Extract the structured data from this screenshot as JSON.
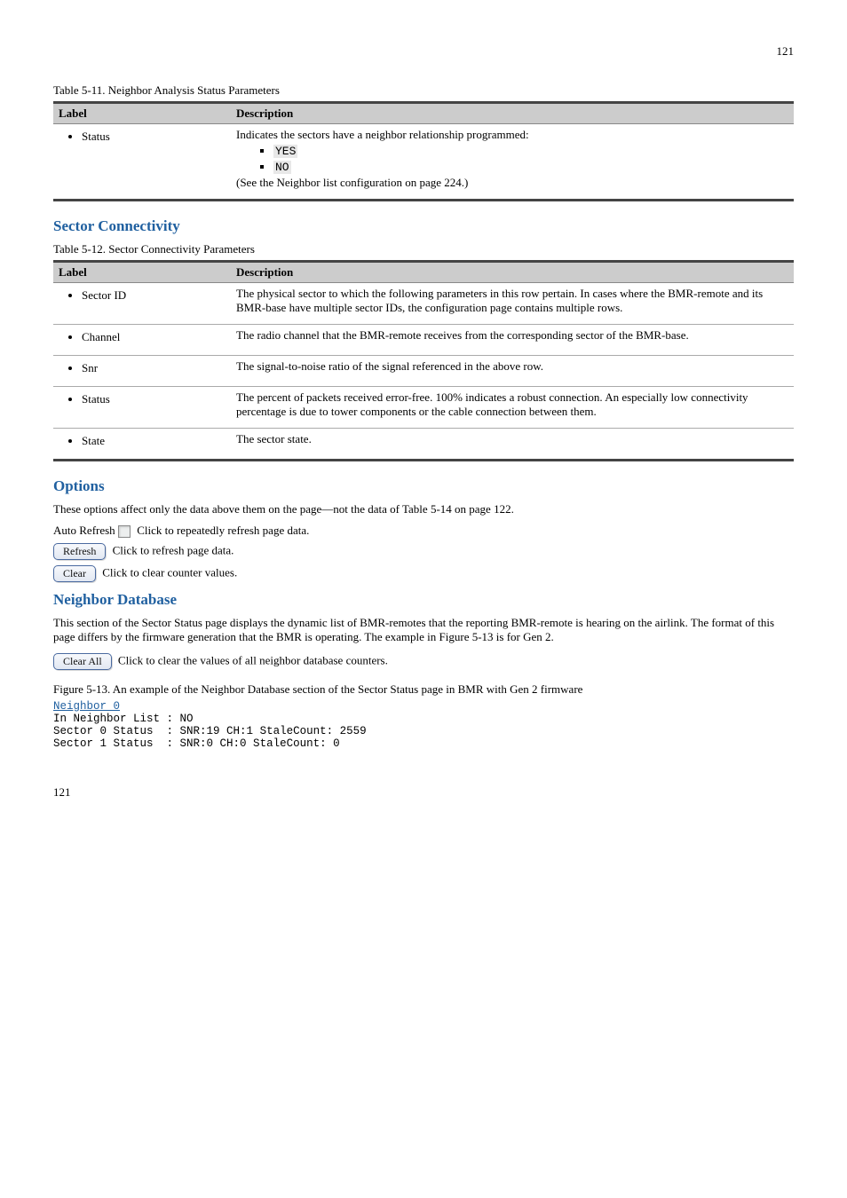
{
  "page": {
    "top_number": "121",
    "bottom_number": "121"
  },
  "table5": {
    "caption": "Table 5-11. Neighbor Analysis Status Parameters",
    "headers": [
      "Label",
      "Description"
    ],
    "rows": [
      {
        "label": "Status",
        "desc_line1": "Indicates the sectors have a neighbor relationship programmed:",
        "sub_items": [
          "YES",
          "NO"
        ],
        "sub_note": "(See the Neighbor list configuration on page 224.)"
      }
    ]
  },
  "section_heading": "Sector Connectivity",
  "table6": {
    "caption": "Table 5-12. Sector Connectivity Parameters",
    "headers": [
      "Label",
      "Description"
    ],
    "rows": [
      {
        "label": "Sector ID",
        "desc": "The physical sector to which the following parameters in this row pertain. In cases where the BMR-remote and its BMR-base have multiple sector IDs, the configuration page contains multiple rows."
      },
      {
        "label": "Channel",
        "desc": "The radio channel that the BMR-remote receives from the corresponding sector of the BMR-base."
      },
      {
        "label": "Snr",
        "desc": "The signal-to-noise ratio of the signal referenced in the above row."
      },
      {
        "label": "Status",
        "desc": "The percent of packets received error-free. 100% indicates a robust connection. An especially low connectivity percentage is due to tower components or the cable connection between them."
      },
      {
        "label": "State",
        "desc": "The sector state."
      }
    ]
  },
  "options": {
    "heading": "Options",
    "intro_text": "These options affect only the data above them on the page—not the data of Table 5-14 on page 122.",
    "auto_refresh": {
      "label": "Auto Refresh",
      "desc": "Click to repeatedly refresh page data."
    },
    "refresh_btn": {
      "label": "Refresh",
      "desc": "Click to refresh page data."
    },
    "clear_btn": {
      "label": "Clear",
      "desc": "Click to clear counter values."
    }
  },
  "neighbor_db": {
    "heading": "Neighbor Database",
    "para": "This section of the Sector Status page displays the dynamic list of BMR-remotes that the reporting BMR-remote is hearing on the airlink. The format of this page differs by the firmware generation that the BMR is operating. The example in Figure 5-13 is for Gen 2.",
    "clearall_btn": {
      "label": "Clear All",
      "desc": "Click to clear the values of all neighbor database counters."
    },
    "caption": "Figure 5-13. An example of the Neighbor Database section of the Sector Status page in BMR with Gen 2 firmware"
  },
  "preblock": {
    "heading": "Neighbor 0",
    "rows": [
      {
        "k": "In Neighbor List ",
        "v": " NO"
      },
      {
        "k": "Sector 0 Status  ",
        "v": " SNR:19 CH:1 StaleCount: 2559"
      },
      {
        "k": "Sector 1 Status  ",
        "v": " SNR:0 CH:0 StaleCount: 0"
      }
    ]
  }
}
